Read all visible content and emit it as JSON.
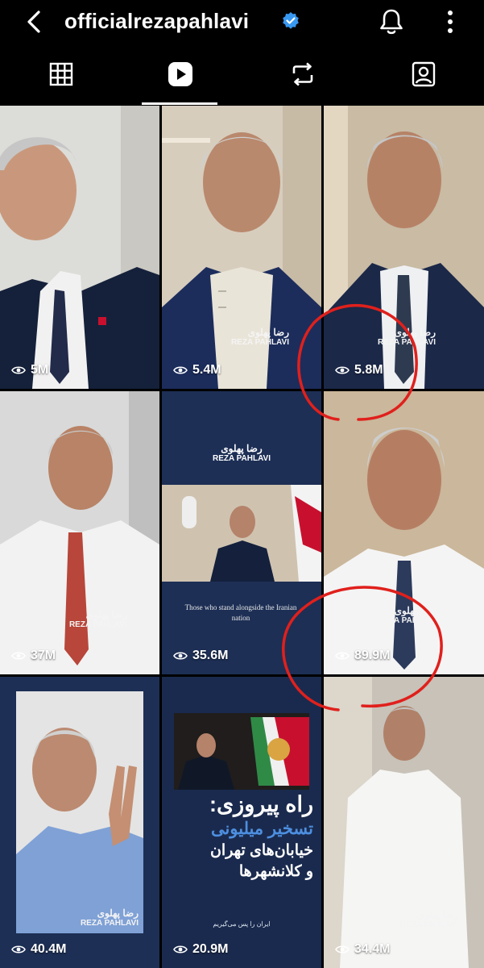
{
  "header": {
    "username": "officialrezapahlavi",
    "verified": true,
    "icons": [
      "chevron-left-icon",
      "verified-badge-icon",
      "bell-icon",
      "more-vertical-icon"
    ]
  },
  "tabs": [
    {
      "name": "posts-grid",
      "icon": "grid-icon",
      "active": false
    },
    {
      "name": "reels",
      "icon": "reels-play-icon",
      "active": true
    },
    {
      "name": "reposts",
      "icon": "repost-icon",
      "active": false
    },
    {
      "name": "tagged",
      "icon": "tagged-user-icon",
      "active": false
    }
  ],
  "reels": [
    {
      "views": "5M",
      "watermark": false
    },
    {
      "views": "5.4M",
      "watermark": true
    },
    {
      "views": "5.8M",
      "watermark": true,
      "highlighted": true
    },
    {
      "views": "37M",
      "watermark": true
    },
    {
      "views": "35.6M",
      "watermark": false,
      "brand": true,
      "caption": "Those who stand alongside the Iranian nation"
    },
    {
      "views": "89.9M",
      "watermark": true,
      "highlighted": true
    },
    {
      "views": "40.4M",
      "watermark": true
    },
    {
      "views": "20.9M",
      "watermark": false,
      "headline": [
        "راه پیروزی:",
        "تسخیر میلیونی",
        "خیابان‌های تهران",
        "و کلانشهرها"
      ],
      "footnote": "ایران را پس می‌گیریم"
    },
    {
      "views": "34.4M",
      "watermark": true
    }
  ],
  "watermark": {
    "fa": "رضا پهلوی",
    "en": "REZA PAHLAVI"
  },
  "colors": {
    "background": "#000000",
    "highlight_circle": "#e0201c",
    "navy": "#1d2f55"
  }
}
